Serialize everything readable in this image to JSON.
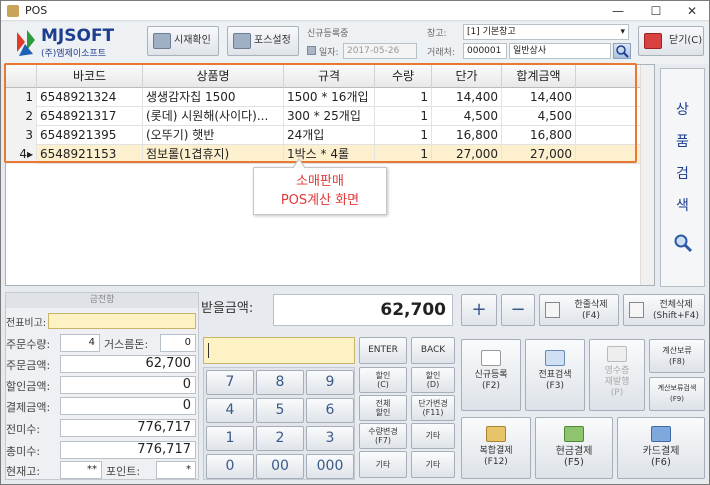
{
  "window": {
    "title": "POS"
  },
  "logo": {
    "name": "MJSOFT",
    "company": "(주)엠제이소프트"
  },
  "toolbar": {
    "time_check": "시재확인",
    "pos_settings": "포스설정",
    "close": "닫기(C)"
  },
  "header": {
    "new_reg_label": "신규등록중",
    "date_label": "일자:",
    "date_value": "2017-05-26",
    "warehouse_label": "창고:",
    "warehouse_value": "[1] 기본창고",
    "customer_label": "거래처:",
    "customer_code": "000001",
    "customer_name": "일반상사"
  },
  "table": {
    "columns": [
      "바코드",
      "상품명",
      "규격",
      "수량",
      "단가",
      "합계금액"
    ],
    "rows": [
      {
        "no": "1",
        "barcode": "6548921324",
        "name": "생생감자칩 1500",
        "spec": "1500 * 16개입",
        "qty": "1",
        "price": "14,400",
        "total": "14,400"
      },
      {
        "no": "2",
        "barcode": "6548921317",
        "name": "(롯데) 시원해(사이다)...",
        "spec": "300 * 25개입",
        "qty": "1",
        "price": "4,500",
        "total": "4,500"
      },
      {
        "no": "3",
        "barcode": "6548921395",
        "name": "(오뚜기) 햇반",
        "spec": "24개입",
        "qty": "1",
        "price": "16,800",
        "total": "16,800"
      },
      {
        "no": "4",
        "barcode": "6548921153",
        "name": "점보롤(1겹휴지)",
        "spec": "1박스 * 4롤",
        "qty": "1",
        "price": "27,000",
        "total": "27,000"
      }
    ]
  },
  "callout": {
    "line1": "소매판매",
    "line2": "POS계산 화면"
  },
  "side": {
    "chars": [
      "상",
      "품",
      "검",
      "색"
    ]
  },
  "left_panel": {
    "header": "금전함",
    "memo_label": "전표비고:",
    "qty_label": "주문수량:",
    "qty_value": "4",
    "change_label": "거스름돈:",
    "change_value": "0",
    "order_amount_label": "주문금액:",
    "order_amount": "62,700",
    "discount_label": "할인금액:",
    "discount": "0",
    "paid_label": "결제금액:",
    "paid": "0",
    "prev_unpaid_label": "전미수:",
    "prev_unpaid": "776,717",
    "total_unpaid_label": "총미수:",
    "total_unpaid": "776,717",
    "stock_label": "현재고:",
    "stock_value": "**",
    "point_label": "포인트:",
    "point_value": "*"
  },
  "receive": {
    "label": "받을금액:",
    "value": "62,700"
  },
  "keys": {
    "plus": "+",
    "minus": "−",
    "enter": "ENTER",
    "back": "BACK",
    "digits": [
      "7",
      "8",
      "9",
      "4",
      "5",
      "6",
      "1",
      "2",
      "3",
      "0",
      "00",
      "000"
    ],
    "disc_c": "할인\n(C)",
    "disc_d": "할인\n(D)",
    "total_disc": "전체\n할인",
    "price_change": "단가변경\n(F11)",
    "qty_change": "수량변경\n(F7)",
    "etc1": "기타",
    "etc2": "기타",
    "etc3": "기타"
  },
  "actions": {
    "delete_one": "한줄삭제\n(F4)",
    "delete_all": "전체삭제\n(Shift+F4)",
    "new_reg": "신규등록\n(F2)",
    "slip_search": "전표검색\n(F3)",
    "receipt_reprint": "영수증\n재발행\n(P)",
    "hold": "계산보류\n(F8)",
    "hold_search": "계산보류검색\n(F9)",
    "complex_pay": "복합결제\n(F12)",
    "cash_pay": "현금결제\n(F5)",
    "card_pay": "카드결제\n(F6)"
  }
}
